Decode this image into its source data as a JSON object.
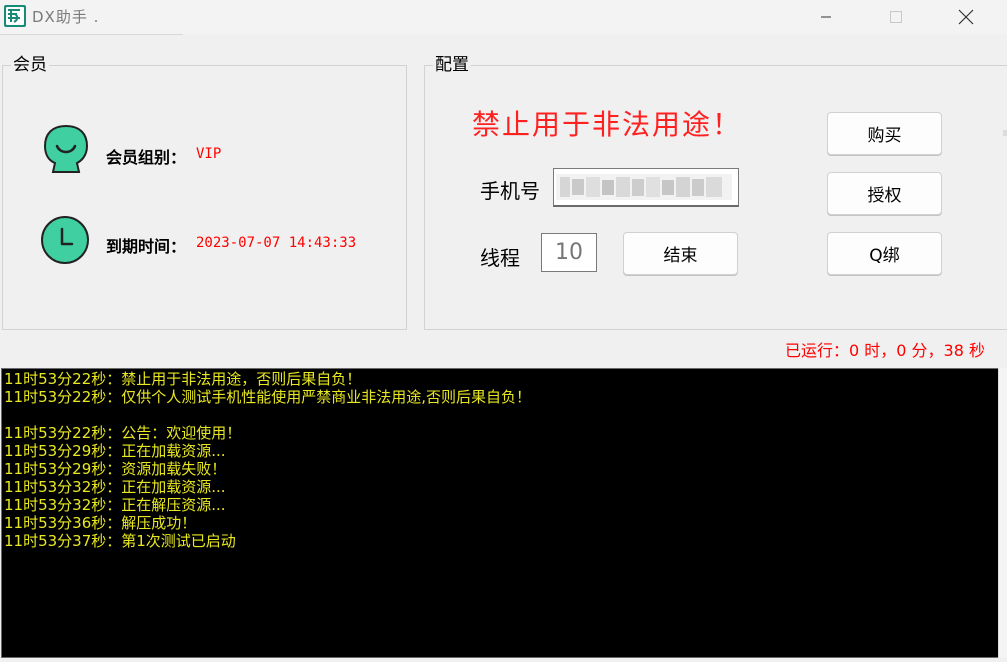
{
  "window": {
    "title": "DX助手 .",
    "icon": "app-logo-icon",
    "controls": [
      "minimize-icon",
      "maximize-icon",
      "close-icon"
    ]
  },
  "member": {
    "legend": "会员",
    "group_label": "会员组别：",
    "group_value": "VIP",
    "expire_label": "到期时间：",
    "expire_value": "2023-07-07 14:43:33",
    "icons": [
      "avatar-icon",
      "clock-icon"
    ]
  },
  "config": {
    "legend": "配置",
    "warning": "禁止用于非法用途！",
    "phone_label": "手机号",
    "phone_value_blurred": true,
    "thread_label": "线程",
    "thread_value": "10",
    "buttons": {
      "buy": "购买",
      "authorize": "授权",
      "qbind": "Q绑",
      "stop": "结束"
    }
  },
  "status": {
    "runtime": "已运行：0 时，0 分，38 秒"
  },
  "console": {
    "lines": [
      "11时53分22秒：禁止用于非法用途，否则后果自负！",
      "11时53分22秒：仅供个人测试手机性能使用严禁商业非法用途,否则后果自负！",
      "",
      "11时53分22秒：公告：欢迎使用！",
      "11时53分29秒：正在加载资源...",
      "11时53分29秒：资源加载失败！",
      "11时53分32秒：正在加载资源...",
      "11时53分32秒：正在解压资源...",
      "11时53分36秒：解压成功！",
      "11时53分37秒：第1次测试已启动"
    ]
  },
  "colors": {
    "accent_red": "#ff0000",
    "console_bg": "#000000",
    "console_text": "#e8e820",
    "icon_teal": "#3fcfa0"
  }
}
